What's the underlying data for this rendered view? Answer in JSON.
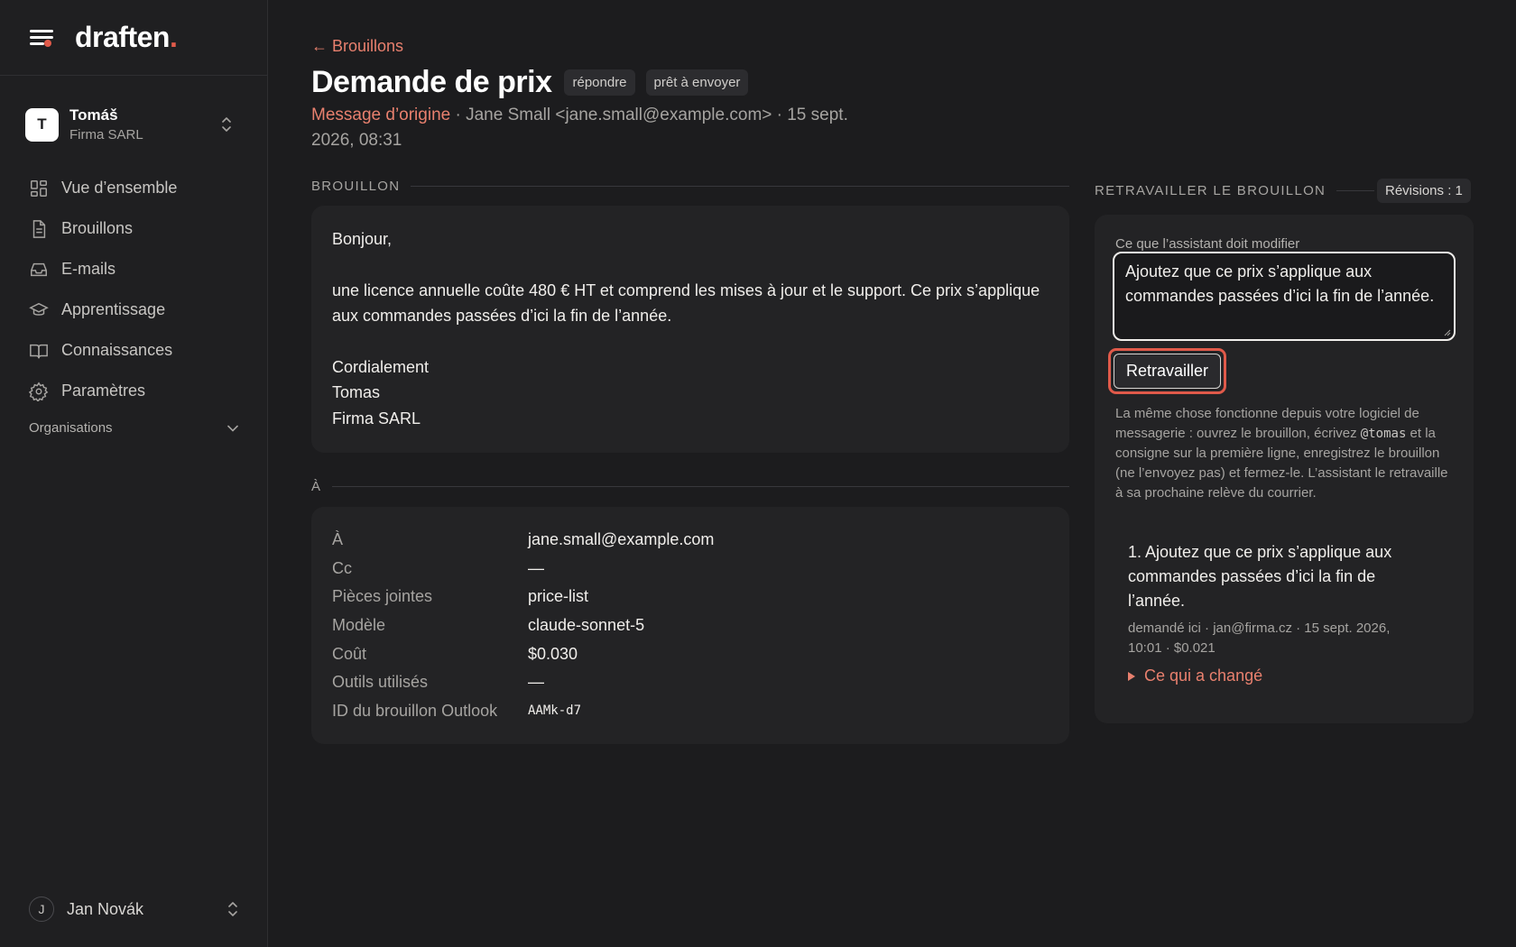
{
  "brand": {
    "name": "draften",
    "dot": "."
  },
  "account": {
    "initial": "T",
    "name": "Tomáš",
    "org": "Firma SARL"
  },
  "nav": {
    "items": [
      {
        "label": "Vue d’ensemble",
        "icon": "dashboard-icon"
      },
      {
        "label": "Brouillons",
        "icon": "document-icon"
      },
      {
        "label": "E-mails",
        "icon": "inbox-icon"
      },
      {
        "label": "Apprentissage",
        "icon": "graduation-cap-icon"
      },
      {
        "label": "Connaissances",
        "icon": "book-icon"
      },
      {
        "label": "Paramètres",
        "icon": "gear-icon"
      }
    ],
    "organisations": "Organisations"
  },
  "user": {
    "initial": "J",
    "name": "Jan Novák"
  },
  "header": {
    "back": "← Brouillons",
    "title": "Demande de prix",
    "chips": [
      "répondre",
      "prêt à envoyer"
    ],
    "origin_link": "Message d’origine",
    "meta": " · Jane Small <jane.small@example.com> · 15 sept. 2026, 08:31"
  },
  "draft": {
    "section_title": "BROUILLON",
    "lines": [
      "Bonjour,",
      "",
      "une licence annuelle coûte 480 € HT et comprend les mises à jour et le support. Ce prix s’applique aux commandes passées d’ici la fin de l’année.",
      "",
      "Cordialement",
      "Tomas",
      "Firma SARL"
    ]
  },
  "details": {
    "section_title": "À",
    "rows": [
      {
        "key": "À",
        "value": "jane.small@example.com",
        "mono": false
      },
      {
        "key": "Cc",
        "value": "—",
        "mono": false
      },
      {
        "key": "Pièces jointes",
        "value": "price-list",
        "mono": false
      },
      {
        "key": "Modèle",
        "value": "claude-sonnet-5",
        "mono": false
      },
      {
        "key": "Coût",
        "value": "$0.030",
        "mono": false
      },
      {
        "key": "Outils utilisés",
        "value": "—",
        "mono": false
      },
      {
        "key": "ID du brouillon Outlook",
        "value": "AAMk-d7",
        "mono": true
      }
    ]
  },
  "rework": {
    "section_title": "RETRAVAILLER LE BROUILLON",
    "revisions": "Révisions : 1",
    "field_label": "Ce que l’assistant doit modifier",
    "field_value": "Ajoutez que ce prix s’applique aux commandes passées d’ici la fin de l’année.",
    "button": "Retravailler",
    "hint_before": "La même chose fonctionne depuis votre logiciel de messagerie : ouvrez le brouillon, écrivez ",
    "hint_code": "@tomas",
    "hint_after": " et la consigne sur la première ligne, enregistrez le brouillon (ne l’envoyez pas) et fermez-le. L’assistant le retravaille à sa prochaine relève du courrier.",
    "revision_item": {
      "text": "1. Ajoutez que ce prix s’applique aux commandes passées d’ici la fin de l’année.",
      "meta": "demandé ici · jan@firma.cz · 15 sept. 2026, 10:01 · $0.021",
      "changed": "Ce qui a changé"
    }
  },
  "colors": {
    "accent": "#e8806e",
    "focus_ring": "#e05a4a",
    "background": "#1c1c1e",
    "card": "#232325"
  }
}
